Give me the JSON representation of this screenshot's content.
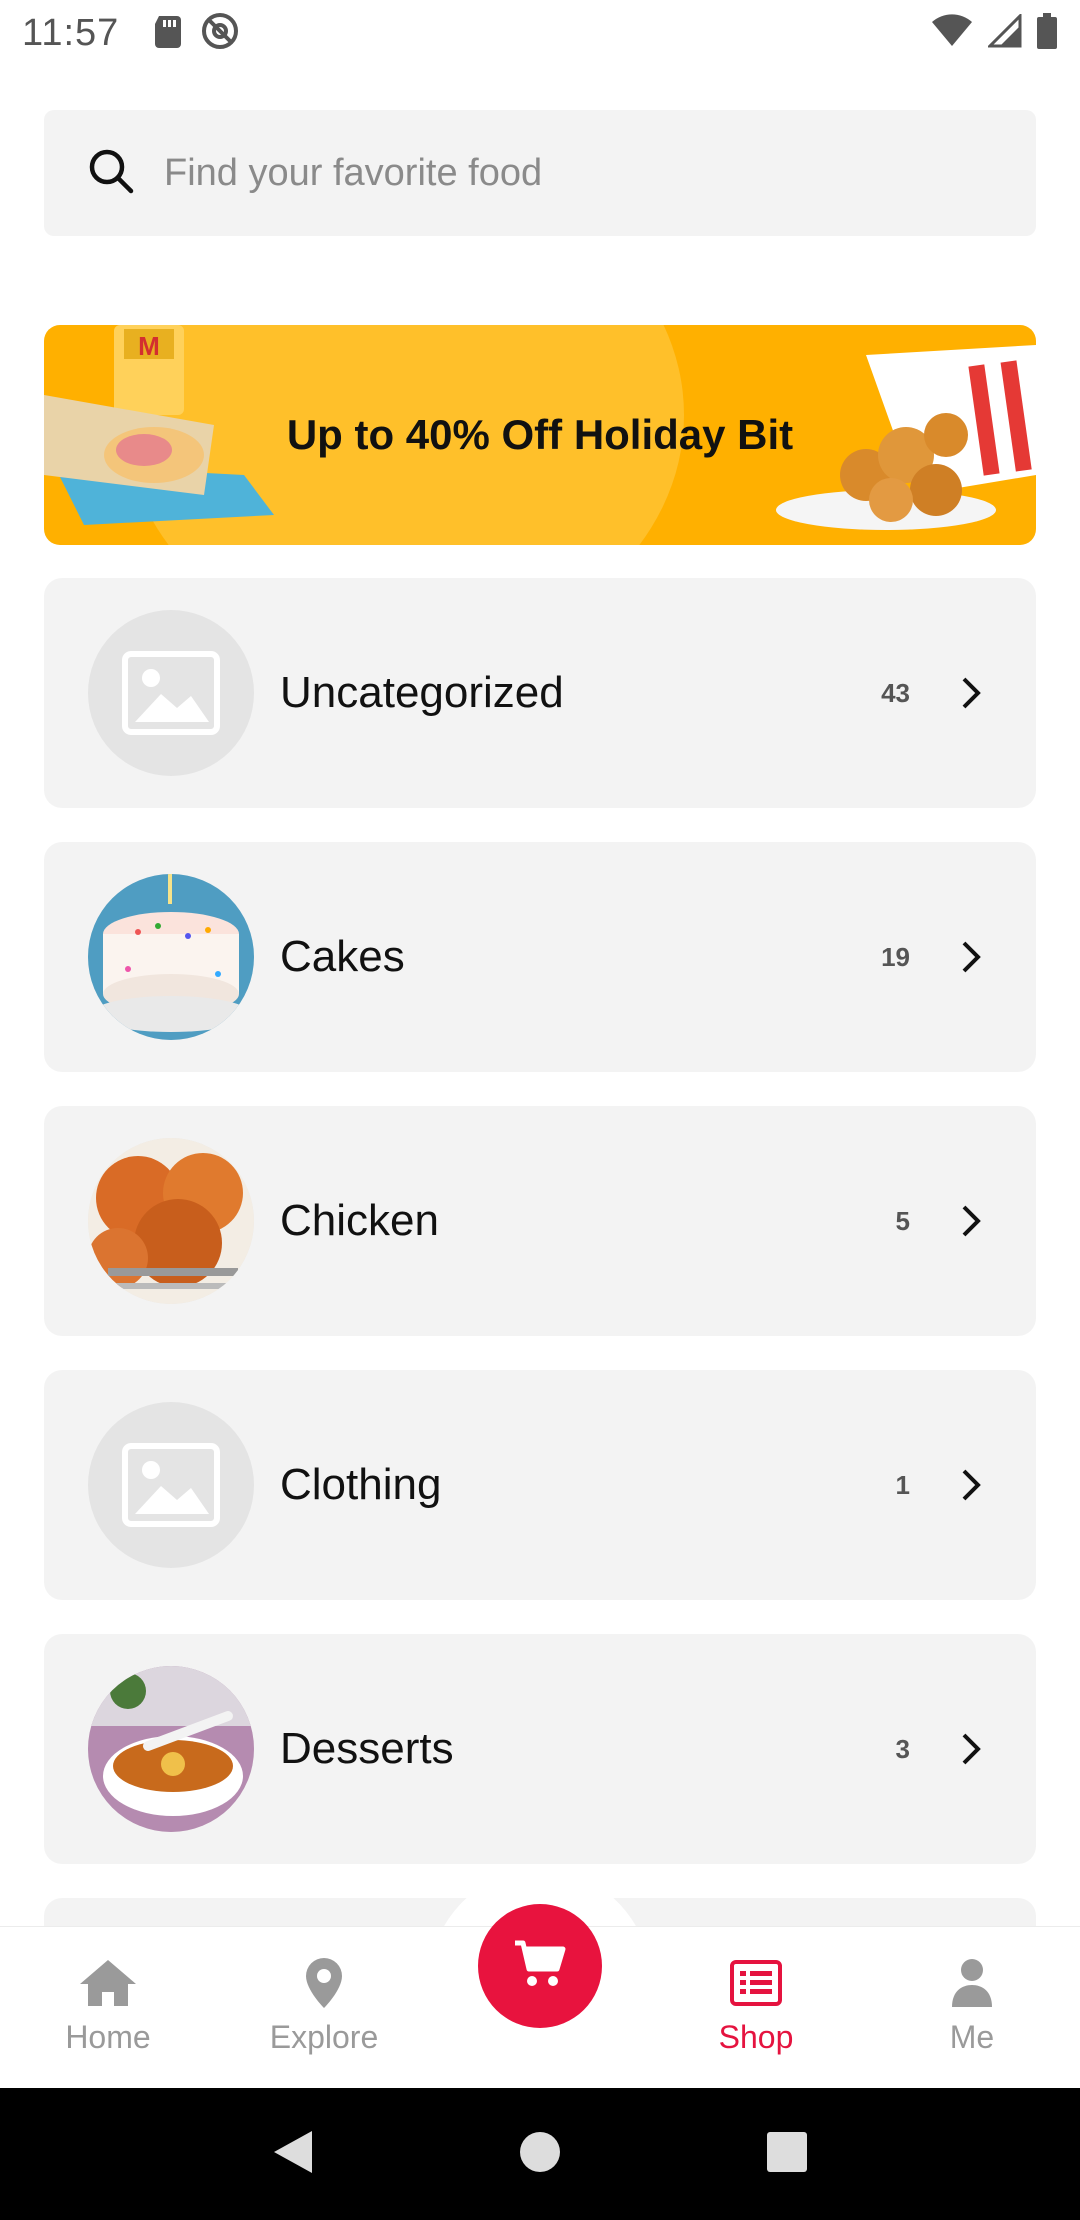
{
  "status_bar": {
    "time": "11:57",
    "left_icons": [
      "sd-card-icon",
      "at-sign-icon"
    ],
    "right_icons": [
      "wifi-icon",
      "signal-icon",
      "battery-icon"
    ]
  },
  "search": {
    "placeholder": "Find your favorite food",
    "icon": "search-icon"
  },
  "banner": {
    "title": "Up to 40% Off Holiday Bit",
    "background_color": "#ffb000"
  },
  "categories": [
    {
      "name": "Uncategorized",
      "count": "43",
      "image": "placeholder-image-icon"
    },
    {
      "name": "Cakes",
      "count": "19",
      "image": "cake-photo"
    },
    {
      "name": "Chicken",
      "count": "5",
      "image": "fried-chicken-photo"
    },
    {
      "name": "Clothing",
      "count": "1",
      "image": "placeholder-image-icon"
    },
    {
      "name": "Desserts",
      "count": "3",
      "image": "soup-dessert-photo"
    }
  ],
  "bottom_nav": {
    "items": [
      {
        "label": "Home",
        "icon": "home-icon",
        "active": false
      },
      {
        "label": "Explore",
        "icon": "location-pin-icon",
        "active": false
      },
      {
        "label": "Shop",
        "icon": "list-icon",
        "active": true
      },
      {
        "label": "Me",
        "icon": "person-icon",
        "active": false
      }
    ],
    "center_button_icon": "cart-icon",
    "accent_color": "#e5133f"
  },
  "system_nav": [
    "back-icon",
    "home-circle-icon",
    "recents-icon"
  ]
}
